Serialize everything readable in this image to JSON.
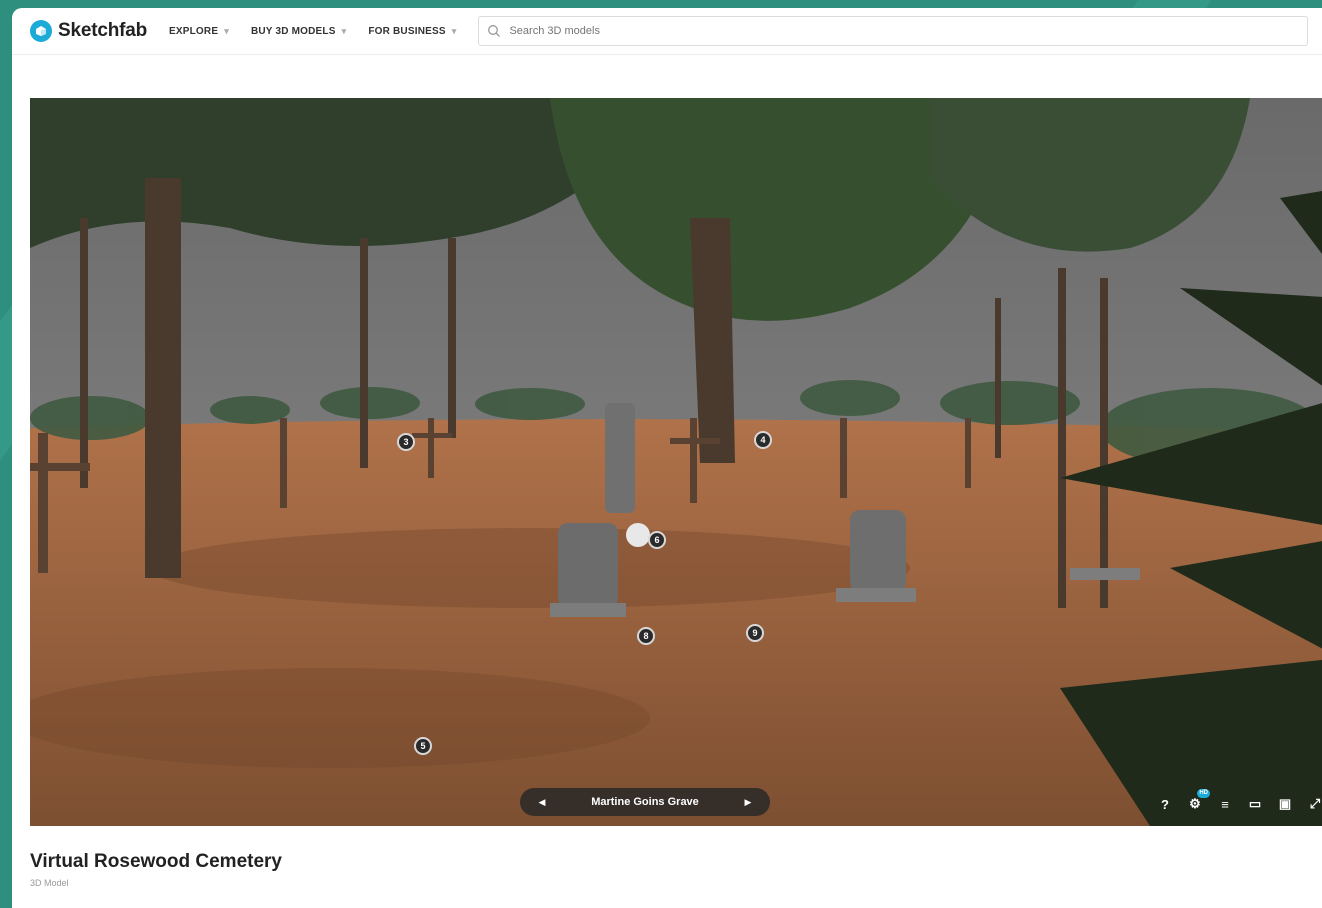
{
  "header": {
    "brand": "Sketchfab",
    "nav": [
      {
        "label": "EXPLORE"
      },
      {
        "label": "BUY 3D MODELS"
      },
      {
        "label": "FOR BUSINESS"
      }
    ],
    "search_placeholder": "Search 3D models"
  },
  "viewer": {
    "hotspots": [
      "3",
      "4",
      "6",
      "8",
      "9",
      "5"
    ],
    "annotation_title": "Martine Goins Grave",
    "controls": {
      "help": "?",
      "settings_badge": "HD"
    }
  },
  "model": {
    "title": "Virtual Rosewood Cemetery",
    "subtitle": "3D Model"
  },
  "colors": {
    "accent": "#1caad9",
    "frame": "#2f8f7f"
  }
}
